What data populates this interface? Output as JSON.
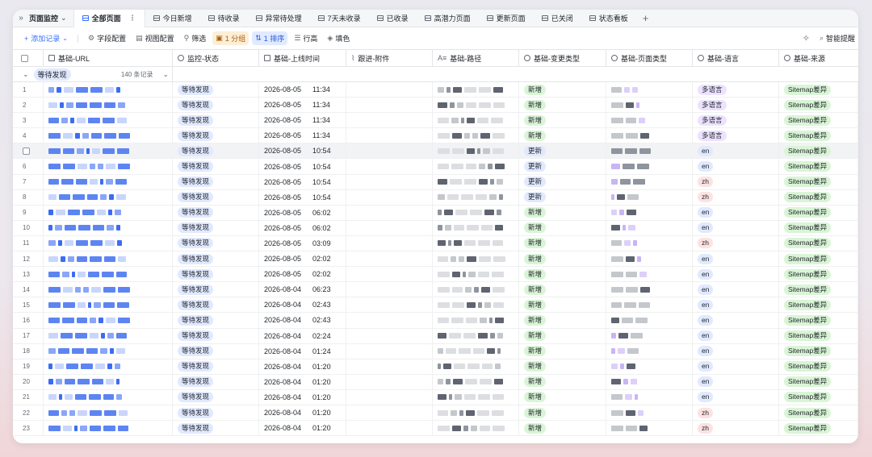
{
  "tabbar": {
    "title": "页面监控",
    "tabs": [
      {
        "label": "全部页面",
        "active": true
      },
      {
        "label": "今日新增"
      },
      {
        "label": "待收录"
      },
      {
        "label": "异常待处理"
      },
      {
        "label": "7天未收录"
      },
      {
        "label": "已收录"
      },
      {
        "label": "高潜力页面"
      },
      {
        "label": "更新页面"
      },
      {
        "label": "已关闭"
      },
      {
        "label": "状态看板"
      }
    ]
  },
  "toolbar": {
    "add_record": "添加记录",
    "field_config": "字段配置",
    "view_config": "视图配置",
    "filter": "筛选",
    "group": "1 分组",
    "sort": "1 排序",
    "row_height": "行高",
    "fill": "填色",
    "smart": "智能提醒"
  },
  "columns": [
    "基础-URL",
    "监控-状态",
    "基础-上线时间",
    "跟进-附件",
    "基础-路径",
    "基础-变更类型",
    "基础-页面类型",
    "基础-语言",
    "基础-来源"
  ],
  "group": {
    "label": "等待发现",
    "count": "140 条记录"
  },
  "rows": [
    {
      "n": "1",
      "status": "等待发现",
      "date": "2026-08-05",
      "time": "11:34",
      "change": "新增",
      "lang": "多语言",
      "source": "Sitemap差异"
    },
    {
      "n": "2",
      "status": "等待发现",
      "date": "2026-08-05",
      "time": "11:34",
      "change": "新增",
      "lang": "多语言",
      "source": "Sitemap差异"
    },
    {
      "n": "3",
      "status": "等待发现",
      "date": "2026-08-05",
      "time": "11:34",
      "change": "新增",
      "lang": "多语言",
      "source": "Sitemap差异"
    },
    {
      "n": "4",
      "status": "等待发现",
      "date": "2026-08-05",
      "time": "11:34",
      "change": "新增",
      "lang": "多语言",
      "source": "Sitemap差异"
    },
    {
      "n": "",
      "status": "等待发现",
      "date": "2026-08-05",
      "time": "10:54",
      "change": "更新",
      "lang": "en",
      "source": "Sitemap差异"
    },
    {
      "n": "6",
      "status": "等待发现",
      "date": "2026-08-05",
      "time": "10:54",
      "change": "更新",
      "lang": "en",
      "source": "Sitemap差异"
    },
    {
      "n": "7",
      "status": "等待发现",
      "date": "2026-08-05",
      "time": "10:54",
      "change": "更新",
      "lang": "zh",
      "source": "Sitemap差异"
    },
    {
      "n": "8",
      "status": "等待发现",
      "date": "2026-08-05",
      "time": "10:54",
      "change": "更新",
      "lang": "zh",
      "source": "Sitemap差异"
    },
    {
      "n": "9",
      "status": "等待发现",
      "date": "2026-08-05",
      "time": "06:02",
      "change": "新增",
      "lang": "en",
      "source": "Sitemap差异"
    },
    {
      "n": "10",
      "status": "等待发现",
      "date": "2026-08-05",
      "time": "06:02",
      "change": "新增",
      "lang": "en",
      "source": "Sitemap差异"
    },
    {
      "n": "11",
      "status": "等待发现",
      "date": "2026-08-05",
      "time": "03:09",
      "change": "新增",
      "lang": "zh",
      "source": "Sitemap差异"
    },
    {
      "n": "12",
      "status": "等待发现",
      "date": "2026-08-05",
      "time": "02:02",
      "change": "新增",
      "lang": "en",
      "source": "Sitemap差异"
    },
    {
      "n": "13",
      "status": "等待发现",
      "date": "2026-08-05",
      "time": "02:02",
      "change": "新增",
      "lang": "en",
      "source": "Sitemap差异"
    },
    {
      "n": "14",
      "status": "等待发现",
      "date": "2026-08-04",
      "time": "06:23",
      "change": "新增",
      "lang": "en",
      "source": "Sitemap差异"
    },
    {
      "n": "15",
      "status": "等待发现",
      "date": "2026-08-04",
      "time": "02:43",
      "change": "新增",
      "lang": "en",
      "source": "Sitemap差异"
    },
    {
      "n": "16",
      "status": "等待发现",
      "date": "2026-08-04",
      "time": "02:43",
      "change": "新增",
      "lang": "en",
      "source": "Sitemap差异"
    },
    {
      "n": "17",
      "status": "等待发现",
      "date": "2026-08-04",
      "time": "02:24",
      "change": "新增",
      "lang": "en",
      "source": "Sitemap差异"
    },
    {
      "n": "18",
      "status": "等待发现",
      "date": "2026-08-04",
      "time": "01:24",
      "change": "新增",
      "lang": "en",
      "source": "Sitemap差异"
    },
    {
      "n": "19",
      "status": "等待发现",
      "date": "2026-08-04",
      "time": "01:20",
      "change": "新增",
      "lang": "en",
      "source": "Sitemap差异"
    },
    {
      "n": "20",
      "status": "等待发现",
      "date": "2026-08-04",
      "time": "01:20",
      "change": "新增",
      "lang": "en",
      "source": "Sitemap差异"
    },
    {
      "n": "21",
      "status": "等待发现",
      "date": "2026-08-04",
      "time": "01:20",
      "change": "新增",
      "lang": "en",
      "source": "Sitemap差异"
    },
    {
      "n": "22",
      "status": "等待发现",
      "date": "2026-08-04",
      "time": "01:20",
      "change": "新增",
      "lang": "zh",
      "source": "Sitemap差异"
    },
    {
      "n": "23",
      "status": "等待发现",
      "date": "2026-08-04",
      "time": "01:20",
      "change": "新增",
      "lang": "zh",
      "source": "Sitemap差异"
    }
  ],
  "colors": {
    "accent": "#3370ff",
    "new": "#d9f5d6",
    "update": "#e1e9ff",
    "zh": "#fde2e2",
    "multi": "#ece2fe"
  }
}
